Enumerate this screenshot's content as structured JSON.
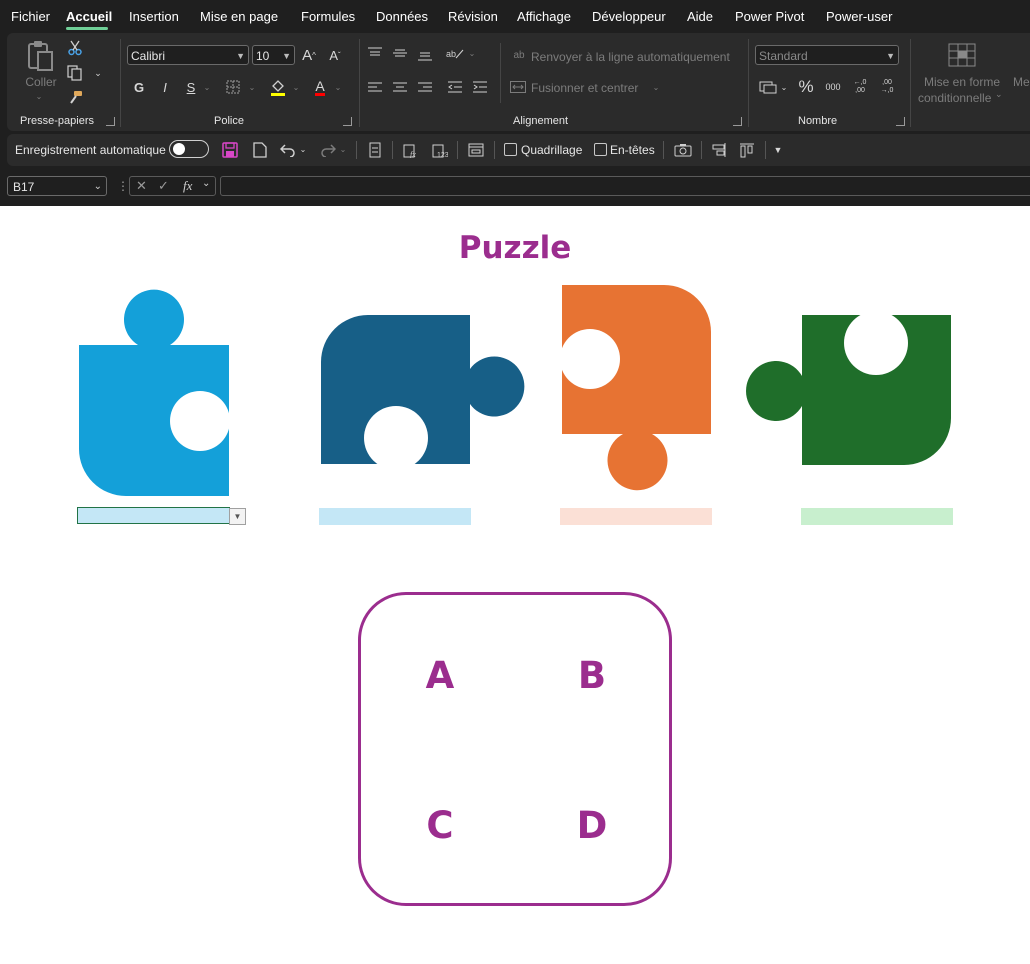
{
  "menu": {
    "items": [
      "Fichier",
      "Accueil",
      "Insertion",
      "Mise en page",
      "Formules",
      "Données",
      "Révision",
      "Affichage",
      "Développeur",
      "Aide",
      "Power Pivot",
      "Power-user"
    ],
    "active": "Accueil"
  },
  "ribbon": {
    "clipboard": {
      "paste_label": "Coller",
      "group_label": "Presse-papiers"
    },
    "font": {
      "font_name": "Calibri",
      "font_size": "10",
      "bold": "G",
      "italic": "I",
      "underline": "S",
      "font_color_letter": "A",
      "group_label": "Police"
    },
    "alignment": {
      "wrap_label": "Renvoyer à la ligne automatiquement",
      "merge_label": "Fusionner et centrer",
      "group_label": "Alignement"
    },
    "number": {
      "format_value": "Standard",
      "percent": "%",
      "thousands": "000",
      "inc_decimal": "←,0 ,00",
      "dec_decimal": ",00 →,0",
      "group_label": "Nombre"
    },
    "styles": {
      "conditional_line1": "Mise en forme",
      "conditional_line2": "conditionnelle",
      "next_partial": "Me"
    }
  },
  "qat": {
    "autosave_label": "Enregistrement automatique",
    "gridlines_label": "Quadrillage",
    "headers_label": "En-têtes"
  },
  "formula_bar": {
    "name_box": "B17",
    "fx": "fx",
    "formula": ""
  },
  "sheet": {
    "title": "Puzzle",
    "pieces": [
      {
        "name": "piece-light-blue",
        "color": "#14a0d9",
        "input_color": "#c4e7f6"
      },
      {
        "name": "piece-dark-blue",
        "color": "#175f87",
        "input_color": "#c4e7f6"
      },
      {
        "name": "piece-orange",
        "color": "#e77333",
        "input_color": "#fbe0d6"
      },
      {
        "name": "piece-green",
        "color": "#1f6e2a",
        "input_color": "#c8efce"
      }
    ],
    "answers": [
      "A",
      "B",
      "C",
      "D"
    ],
    "accent_color": "#9b2d8e"
  }
}
